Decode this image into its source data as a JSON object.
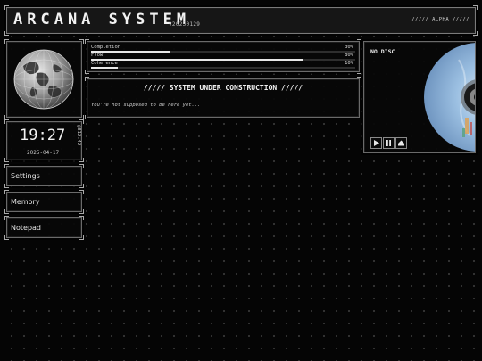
{
  "header": {
    "title": "ARCANA SYSTEM",
    "version": "v20250129",
    "badge": "///// ALPHA /////"
  },
  "clock": {
    "time": "19:27",
    "date": "2025-04-17",
    "code": "@812.42"
  },
  "sidebar": {
    "items": [
      {
        "label": "Settings"
      },
      {
        "label": "Memory"
      },
      {
        "label": "Notepad"
      }
    ]
  },
  "meters": [
    {
      "label": "Completion",
      "percent_text": "30%",
      "value": 30
    },
    {
      "label": "Flow",
      "percent_text": "80%",
      "value": 80
    },
    {
      "label": "Coherence",
      "percent_text": "10%",
      "value": 10
    }
  ],
  "construction": {
    "title": "///// SYSTEM UNDER CONSTRUCTION /////",
    "message": "You're not supposed to be here yet..."
  },
  "player": {
    "status": "NO DISC",
    "controls": [
      "play-icon",
      "pause-icon",
      "eject-icon"
    ]
  },
  "colors": {
    "background": "#050505",
    "panel_border": "#6a6a6a",
    "text": "#e6e6e6",
    "disc": "#8fb6e0"
  }
}
